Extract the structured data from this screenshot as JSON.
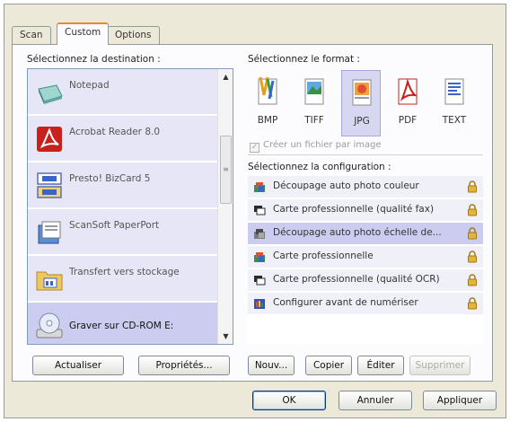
{
  "tabs": [
    {
      "label": "Scan",
      "active": false
    },
    {
      "label": "Custom",
      "active": true
    },
    {
      "label": "Options",
      "active": false
    }
  ],
  "destination": {
    "heading": "Sélectionnez la destination :",
    "items": [
      {
        "label": "Notepad",
        "icon": "notepad-icon"
      },
      {
        "label": "Acrobat Reader 8.0",
        "icon": "acrobat-icon"
      },
      {
        "label": "Presto! BizCard 5",
        "icon": "bizcard-icon"
      },
      {
        "label": "ScanSoft PaperPort",
        "icon": "paperport-icon"
      },
      {
        "label": "Transfert vers stockage",
        "icon": "storage-icon"
      },
      {
        "label": "Graver sur CD-ROM  E:",
        "icon": "cdrom-icon",
        "selected": true
      }
    ]
  },
  "format": {
    "heading": "Sélectionnez le format :",
    "items": [
      {
        "label": "BMP",
        "icon": "bmp-icon"
      },
      {
        "label": "TIFF",
        "icon": "tiff-icon"
      },
      {
        "label": "JPG",
        "icon": "jpg-icon",
        "selected": true
      },
      {
        "label": "PDF",
        "icon": "pdf-icon"
      },
      {
        "label": "TEXT",
        "icon": "text-icon"
      }
    ],
    "checkbox_label": "Créer un fichier par image"
  },
  "configuration": {
    "heading": "Sélectionnez la configuration :",
    "items": [
      {
        "label": "Découpage auto photo couleur",
        "icon": "color-photo-icon"
      },
      {
        "label": "Carte professionnelle (qualité fax)",
        "icon": "card-icon"
      },
      {
        "label": "Découpage auto photo échelle de...",
        "icon": "gray-photo-icon",
        "selected": true
      },
      {
        "label": "Carte professionnelle",
        "icon": "color-photo-icon"
      },
      {
        "label": "Carte professionnelle (qualité OCR)",
        "icon": "card-icon"
      },
      {
        "label": "Configurer avant de numériser",
        "icon": "configure-icon"
      }
    ]
  },
  "buttons": {
    "refresh": "Actualiser",
    "properties": "Propriétés...",
    "new": "Nouv...",
    "copy": "Copier",
    "edit": "Éditer",
    "delete": "Supprimer",
    "ok": "OK",
    "cancel": "Annuler",
    "apply": "Appliquer"
  },
  "scrollbar_grip": "≡",
  "colors": {
    "tab_accent": "#e68b2c",
    "selection": "#ccccf0",
    "list_item": "#e6e6f6",
    "lock": "#e3b53a"
  }
}
